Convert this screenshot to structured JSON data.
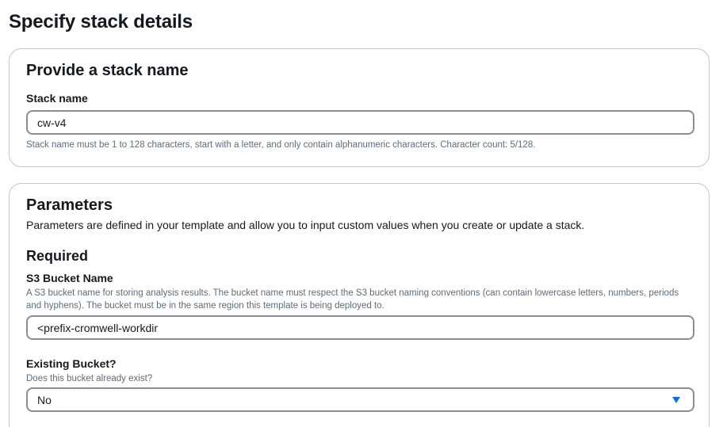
{
  "page": {
    "title": "Specify stack details"
  },
  "stack_name_section": {
    "title": "Provide a stack name",
    "field_label": "Stack name",
    "value": "cw-v4",
    "hint": "Stack name must be 1 to 128 characters, start with a letter, and only contain alphanumeric characters. Character count: 5/128."
  },
  "parameters_section": {
    "title": "Parameters",
    "description": "Parameters are defined in your template and allow you to input custom values when you create or update a stack.",
    "required_heading": "Required",
    "s3_bucket": {
      "label": "S3 Bucket Name",
      "description": "A S3 bucket name for storing analysis results. The bucket name must respect the S3 bucket naming conventions (can contain lowercase letters, numbers, periods and hyphens). The bucket must be in the same region this template is being deployed to.",
      "value": "<prefix-cromwell-workdir"
    },
    "existing_bucket": {
      "label": "Existing Bucket?",
      "description": "Does this bucket already exist?",
      "selected": "No",
      "icon": "caret-down-icon"
    }
  },
  "colors": {
    "accent": "#0972d3",
    "border": "#8c8c94",
    "panel_border": "#c6c6cd",
    "muted_text": "#5f6b7a"
  }
}
